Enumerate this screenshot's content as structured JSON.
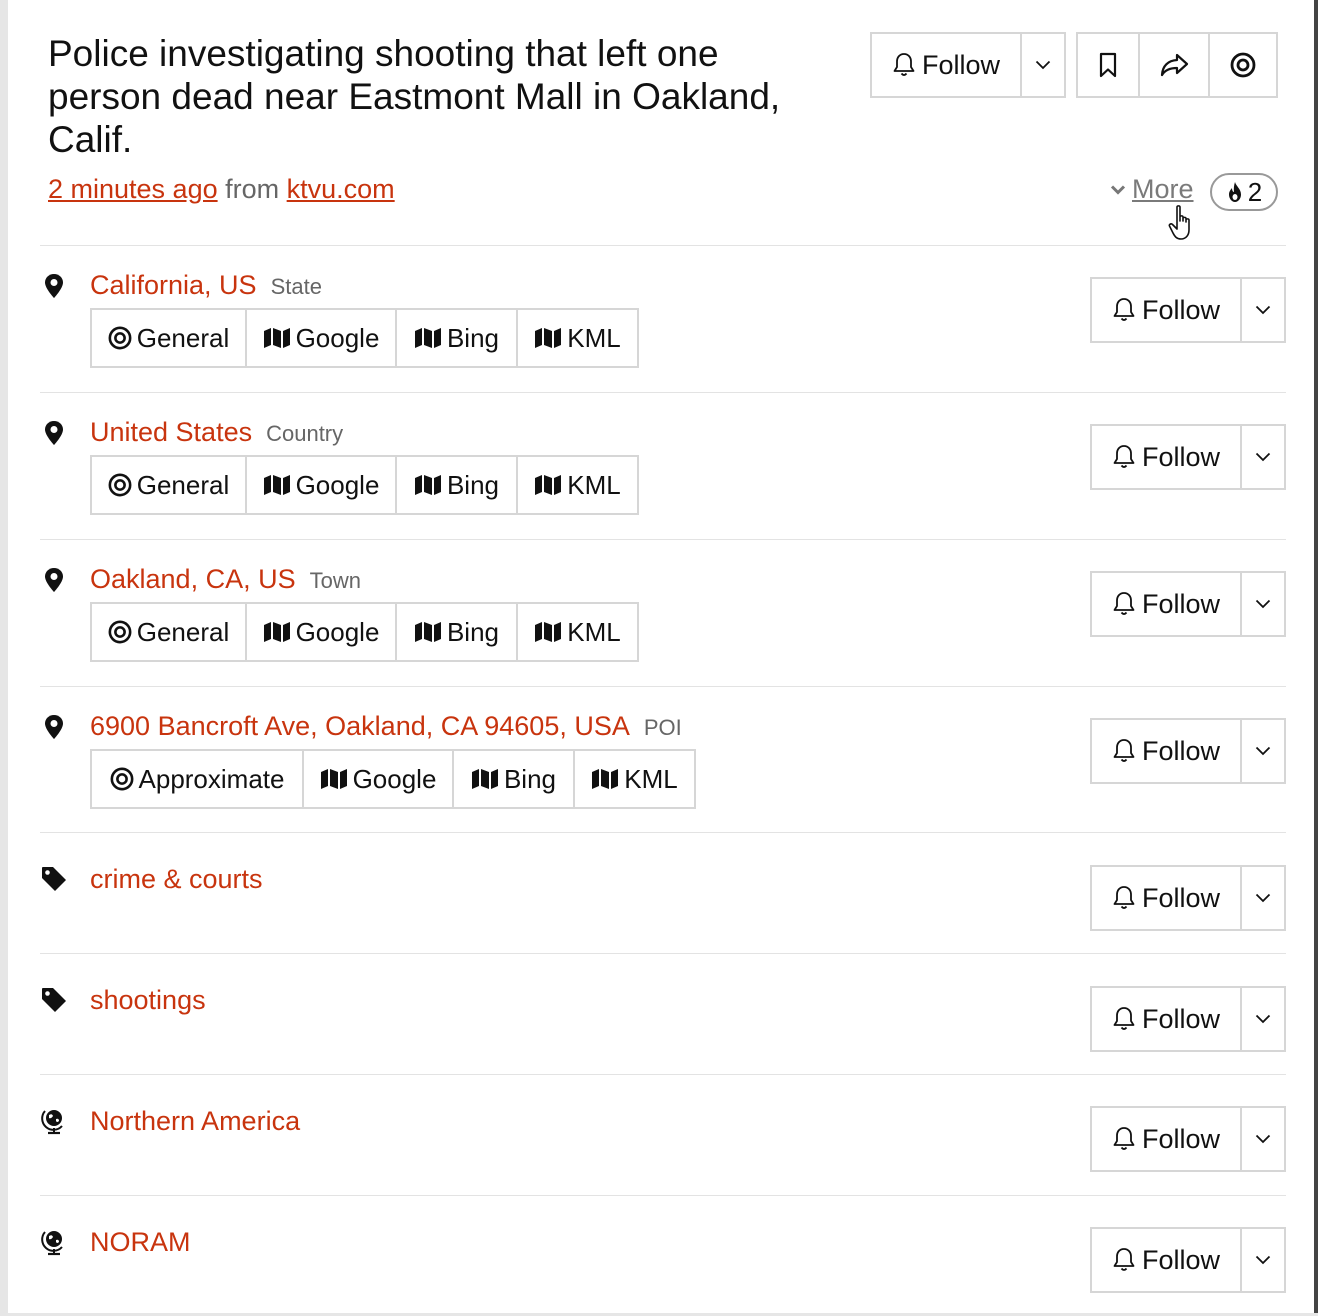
{
  "headline": "Police investigating shooting that left one person dead near Eastmont Mall in Oakland, Calif.",
  "meta": {
    "time": "2 minutes ago",
    "from": "from",
    "source": "ktvu.com"
  },
  "toolbar": {
    "follow_label": "Follow",
    "icons": [
      "bell-icon",
      "chevron-down-icon",
      "bookmark-icon",
      "share-icon",
      "target-icon"
    ]
  },
  "more": {
    "label": "More",
    "badge_count": "2"
  },
  "places": [
    {
      "name": "California, US",
      "type": "State",
      "buttons": [
        "General",
        "Google",
        "Bing",
        "KML"
      ]
    },
    {
      "name": "United States",
      "type": "Country",
      "buttons": [
        "General",
        "Google",
        "Bing",
        "KML"
      ]
    },
    {
      "name": "Oakland, CA, US",
      "type": "Town",
      "buttons": [
        "General",
        "Google",
        "Bing",
        "KML"
      ]
    },
    {
      "name": "6900 Bancroft Ave, Oakland, CA 94605, USA",
      "type": "POI",
      "buttons": [
        "Approximate",
        "Google",
        "Bing",
        "KML"
      ]
    }
  ],
  "tags": [
    "crime & courts",
    "shootings"
  ],
  "regions": [
    "Northern America",
    "NORAM"
  ],
  "follow_label": "Follow",
  "colors": {
    "accent": "#c8340e",
    "border": "#d6d6d6",
    "muted": "#666666"
  }
}
